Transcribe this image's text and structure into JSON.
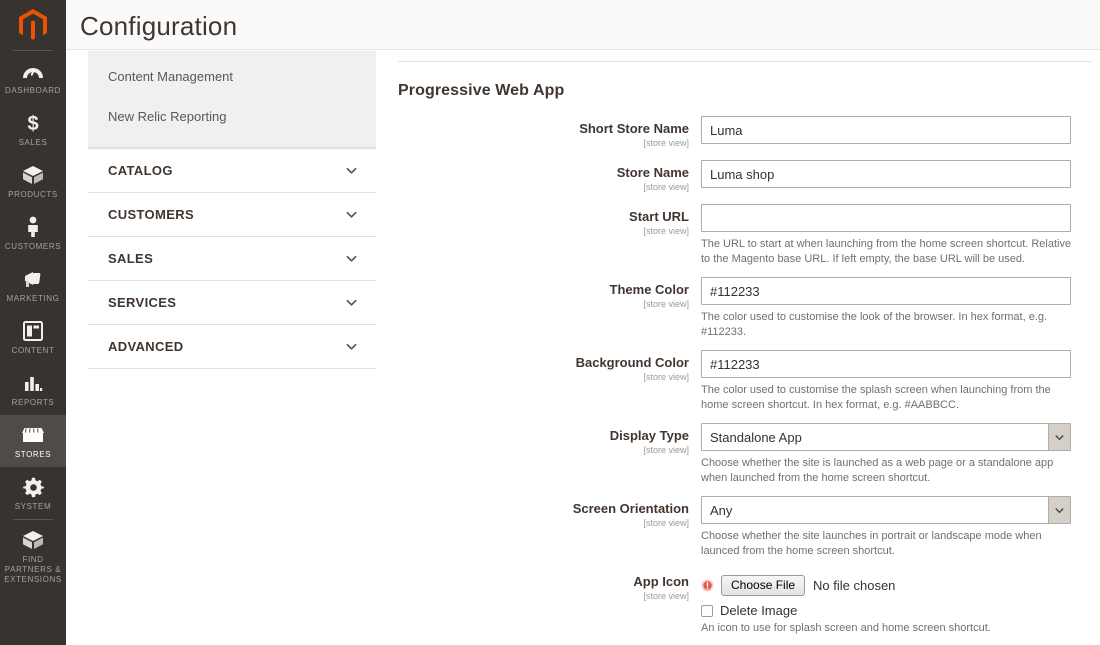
{
  "header": {
    "title": "Configuration"
  },
  "admin_nav": {
    "logo_icon": "magento-logo-icon",
    "items": [
      {
        "label": "DASHBOARD",
        "icon": "dashboard-icon",
        "active": false
      },
      {
        "label": "SALES",
        "icon": "dollar-icon",
        "active": false
      },
      {
        "label": "PRODUCTS",
        "icon": "box-icon",
        "active": false
      },
      {
        "label": "CUSTOMERS",
        "icon": "person-icon",
        "active": false
      },
      {
        "label": "MARKETING",
        "icon": "megaphone-icon",
        "active": false
      },
      {
        "label": "CONTENT",
        "icon": "layout-icon",
        "active": false
      },
      {
        "label": "REPORTS",
        "icon": "bar-chart-icon",
        "active": false
      },
      {
        "label": "STORES",
        "icon": "storefront-icon",
        "active": true
      },
      {
        "label": "SYSTEM",
        "icon": "gear-icon",
        "active": false
      },
      {
        "label": "FIND PARTNERS & EXTENSIONS",
        "icon": "package-icon",
        "active": false
      }
    ]
  },
  "config_nav": {
    "open_group_items": [
      {
        "label": "Content Management"
      },
      {
        "label": "New Relic Reporting"
      }
    ],
    "sections": [
      {
        "label": "CATALOG",
        "icon": "chevron-down-icon"
      },
      {
        "label": "CUSTOMERS",
        "icon": "chevron-down-icon"
      },
      {
        "label": "SALES",
        "icon": "chevron-down-icon"
      },
      {
        "label": "SERVICES",
        "icon": "chevron-down-icon"
      },
      {
        "label": "ADVANCED",
        "icon": "chevron-down-icon"
      }
    ]
  },
  "form": {
    "section_heading": "Progressive Web App",
    "scope_label": "[store view]",
    "fields": [
      {
        "label": "Short Store Name",
        "scope": "[store view]",
        "type": "text",
        "value": "Luma",
        "help": ""
      },
      {
        "label": "Store Name",
        "scope": "[store view]",
        "type": "text",
        "value": "Luma shop",
        "help": ""
      },
      {
        "label": "Start URL",
        "scope": "[store view]",
        "type": "text",
        "value": "",
        "help": "The URL to start at when launching from the home screen shortcut. Relative to the Magento base URL. If left empty, the base URL will be used."
      },
      {
        "label": "Theme Color",
        "scope": "[store view]",
        "type": "text",
        "value": "#112233",
        "help": "The color used to customise the look of the browser. In hex format, e.g. #112233."
      },
      {
        "label": "Background Color",
        "scope": "[store view]",
        "type": "text",
        "value": "#112233",
        "help": "The color used to customise the splash screen when launching from the home screen shortcut. In hex format, e.g. #AABBCC."
      },
      {
        "label": "Display Type",
        "scope": "[store view]",
        "type": "select",
        "value": "Standalone App",
        "help": "Choose whether the site is launched as a web page or a standalone app when launched from the home screen shortcut."
      },
      {
        "label": "Screen Orientation",
        "scope": "[store view]",
        "type": "select",
        "value": "Any",
        "help": "Choose whether the site launches in portrait or landscape mode when launced from the home screen shortcut."
      }
    ],
    "app_icon_field": {
      "label": "App Icon",
      "scope": "[store view]",
      "required_icon": "required-indicator-icon",
      "choose_file_label": "Choose File",
      "no_file_text": "No file chosen",
      "delete_image_label": "Delete Image",
      "help": "An icon to use for splash screen and home screen shortcut."
    }
  },
  "colors": {
    "nav_background": "#373330",
    "nav_active": "#4f4b48",
    "brand_orange": "#eb5202",
    "header_background": "#fafafa",
    "text_dark": "#41362f",
    "help_text": "#707070",
    "input_border": "#adadad",
    "required_marker": "#e05c4a"
  }
}
